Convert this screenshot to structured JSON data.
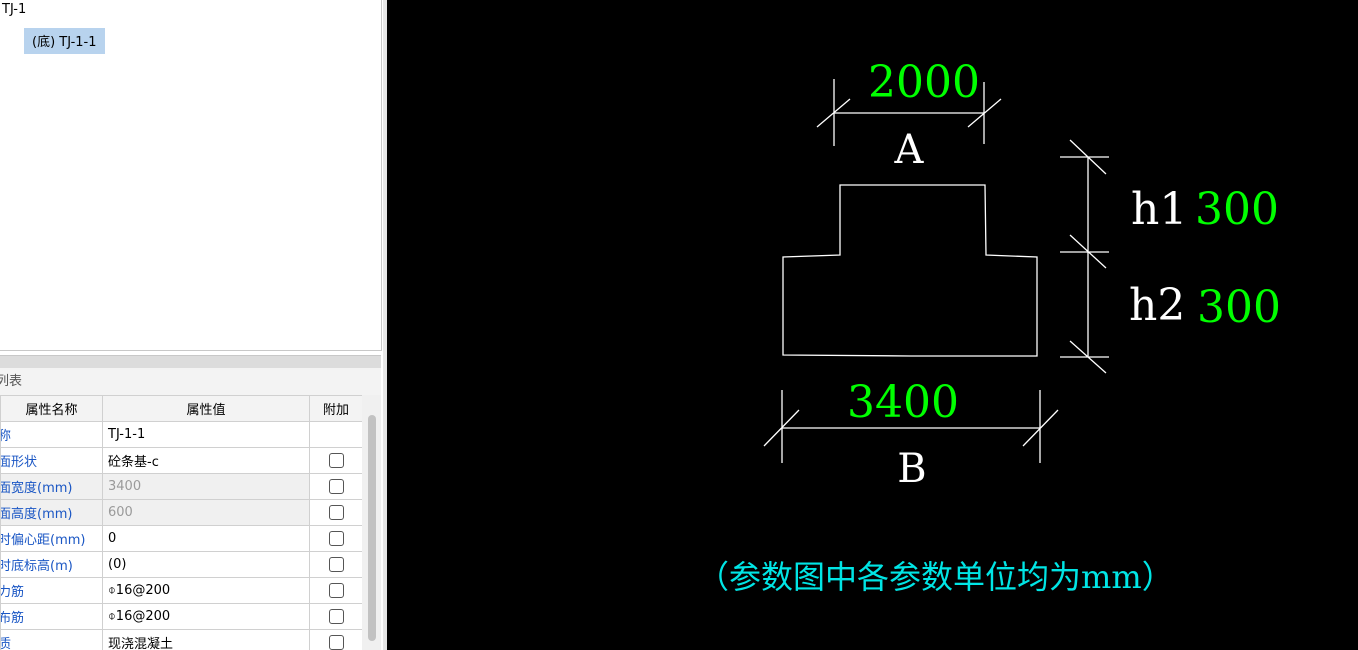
{
  "tree": {
    "root_label": "TJ-1",
    "child_label": "(底) TJ-1-1"
  },
  "properties": {
    "panel_title": "列表",
    "headers": {
      "name": "属性名称",
      "value": "属性值",
      "extra": "附加"
    },
    "rows": [
      {
        "name": "称",
        "value": "TJ-1-1",
        "disabled": false,
        "has_checkbox": false
      },
      {
        "name": "面形状",
        "value": "砼条基-c",
        "disabled": false,
        "has_checkbox": true
      },
      {
        "name": "面宽度(mm)",
        "value": "3400",
        "disabled": true,
        "has_checkbox": true
      },
      {
        "name": "面高度(mm)",
        "value": "600",
        "disabled": true,
        "has_checkbox": true
      },
      {
        "name": "时偏心距(mm)",
        "value": "0",
        "disabled": false,
        "has_checkbox": true
      },
      {
        "name": "时底标高(m)",
        "value": "(0)",
        "disabled": false,
        "has_checkbox": true
      },
      {
        "name": "力筋",
        "value": "⌽16@200",
        "disabled": false,
        "has_checkbox": true
      },
      {
        "name": "布筋",
        "value": "⌽16@200",
        "disabled": false,
        "has_checkbox": true
      },
      {
        "name": "质",
        "value": "现浇混凝土",
        "disabled": false,
        "has_checkbox": true
      }
    ]
  },
  "drawing": {
    "dim_top_value": "2000",
    "dim_top_label": "A",
    "dim_bottom_value": "3400",
    "dim_bottom_label": "B",
    "h1_label": "h1",
    "h1_value": "300",
    "h2_label": "h2",
    "h2_value": "300",
    "note": "（参数图中各参数单位均为mm）",
    "colors": {
      "background": "#000000",
      "lines": "#ffffff",
      "values": "#00ff00",
      "note": "#00e5e5"
    }
  }
}
